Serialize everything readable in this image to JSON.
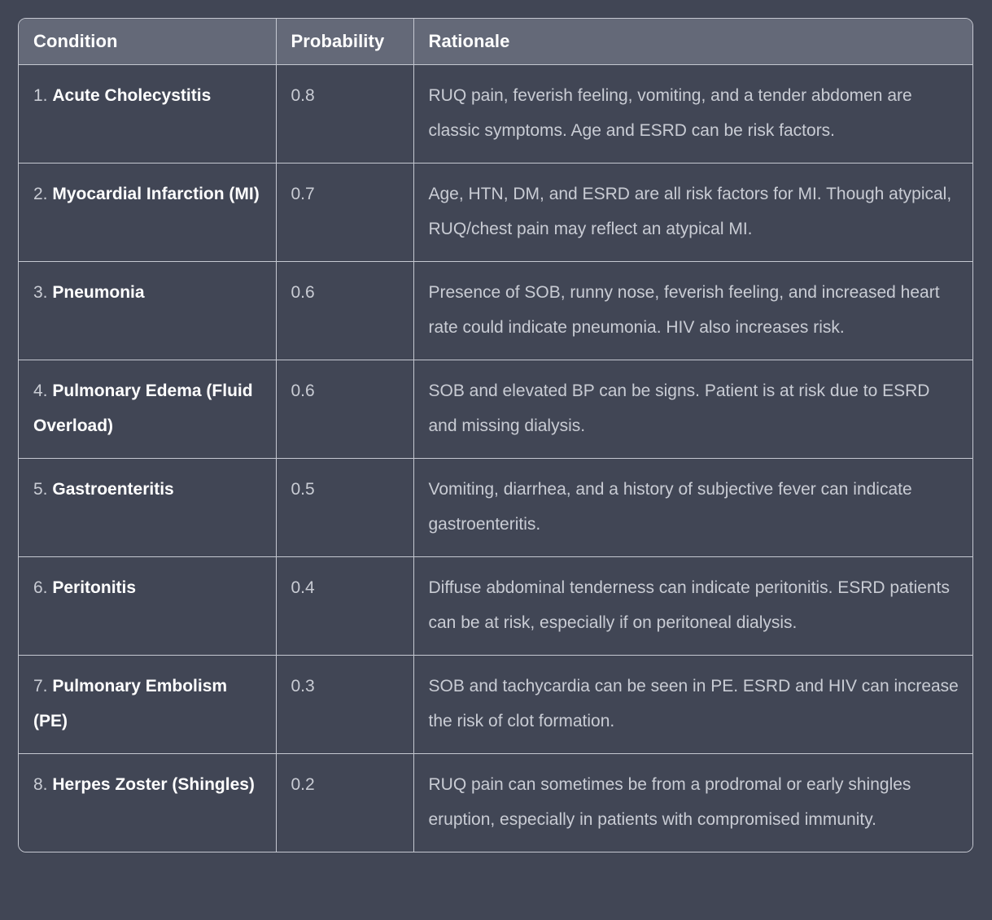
{
  "table": {
    "columns": [
      {
        "key": "condition",
        "label": "Condition"
      },
      {
        "key": "probability",
        "label": "Probability"
      },
      {
        "key": "rationale",
        "label": "Rationale"
      }
    ],
    "rows": [
      {
        "index": "1.",
        "condition": "Acute Cholecystitis",
        "probability": "0.8",
        "rationale": "RUQ pain, feverish feeling, vomiting, and a tender abdomen are classic symptoms. Age and ESRD can be risk factors."
      },
      {
        "index": "2.",
        "condition": "Myocardial Infarction (MI)",
        "probability": "0.7",
        "rationale": "Age, HTN, DM, and ESRD are all risk factors for MI. Though atypical, RUQ/chest pain may reflect an atypical MI."
      },
      {
        "index": "3.",
        "condition": "Pneumonia",
        "probability": "0.6",
        "rationale": "Presence of SOB, runny nose, feverish feeling, and increased heart rate could indicate pneumonia. HIV also increases risk."
      },
      {
        "index": "4.",
        "condition": "Pulmonary Edema (Fluid Overload)",
        "probability": "0.6",
        "rationale": "SOB and elevated BP can be signs. Patient is at risk due to ESRD and missing dialysis."
      },
      {
        "index": "5.",
        "condition": "Gastroenteritis",
        "probability": "0.5",
        "rationale": "Vomiting, diarrhea, and a history of subjective fever can indicate gastroenteritis."
      },
      {
        "index": "6.",
        "condition": "Peritonitis",
        "probability": "0.4",
        "rationale": "Diffuse abdominal tenderness can indicate peritonitis. ESRD patients can be at risk, especially if on peritoneal dialysis."
      },
      {
        "index": "7.",
        "condition": "Pulmonary Embolism (PE)",
        "probability": "0.3",
        "rationale": "SOB and tachycardia can be seen in PE. ESRD and HIV can increase the risk of clot formation."
      },
      {
        "index": "8.",
        "condition": "Herpes Zoster (Shingles)",
        "probability": "0.2",
        "rationale": "RUQ pain can sometimes be from a prodromal or early shingles eruption, especially in patients with compromised immunity."
      }
    ]
  },
  "colors": {
    "page_background": "#414655",
    "header_background": "#646978",
    "row_background": "#414655",
    "border": "#c5c8d1",
    "header_text": "#ffffff",
    "body_text": "#c9ccd4",
    "condition_name_text": "#ffffff"
  }
}
